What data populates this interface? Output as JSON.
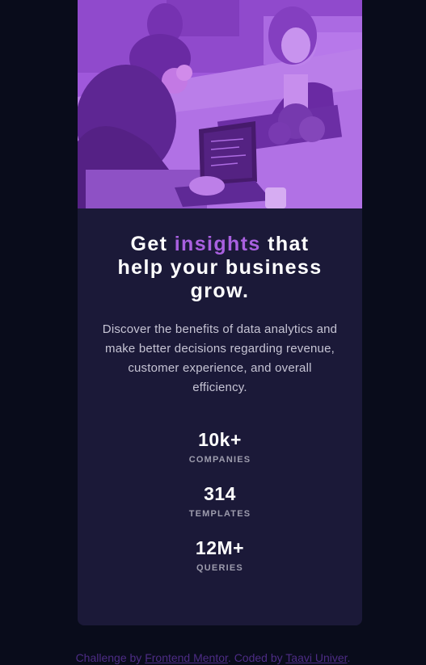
{
  "card": {
    "title_prefix": "Get ",
    "title_accent": "insights",
    "title_suffix": " that help your business grow.",
    "description": "Discover the benefits of data analytics and make better decisions regarding revenue, customer experience, and overall efficiency.",
    "stats": [
      {
        "value": "10k+",
        "label": "COMPANIES"
      },
      {
        "value": "314",
        "label": "TEMPLATES"
      },
      {
        "value": "12M+",
        "label": "QUERIES"
      }
    ]
  },
  "attribution": {
    "prefix": "Challenge by ",
    "frontend_mentor": "Frontend Mentor",
    "middle": ". Coded by ",
    "author": "Taavi Univer",
    "suffix": "."
  },
  "colors": {
    "page_bg": "#090c1b",
    "card_bg": "#1b1938",
    "accent": "#a960e0",
    "image_tint": "#9d55d8"
  }
}
